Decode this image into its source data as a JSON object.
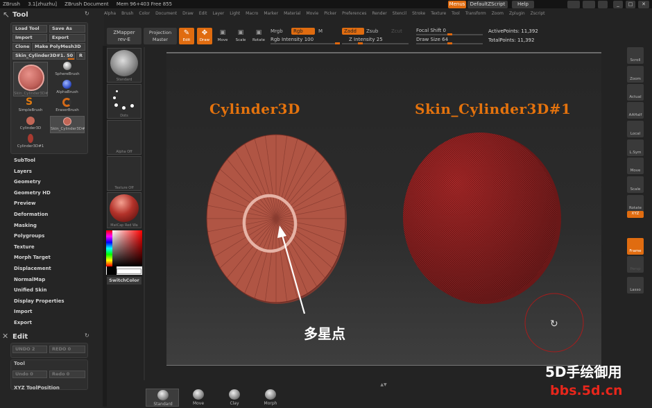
{
  "titlebar": {
    "app": "ZBrush",
    "version": "3.1[zhuzhu]",
    "document": "ZBrush Document",
    "mem": "Mem 96+403 Free 855"
  },
  "menubar": [
    "Alpha",
    "Brush",
    "Color",
    "Document",
    "Draw",
    "Edit",
    "Layer",
    "Light",
    "Macro",
    "Marker",
    "Material",
    "Movie",
    "Picker",
    "Preferences",
    "Render",
    "Stencil",
    "Stroke",
    "Texture",
    "Tool",
    "Transform",
    "Zoom",
    "Zplugin",
    "Zscript"
  ],
  "topright": {
    "menus": "Menus",
    "script": "DefaultZScript",
    "help": "Help"
  },
  "tool_panel": {
    "title": "Tool",
    "load_tool": "Load Tool",
    "save_as": "Save As",
    "import": "Import",
    "export": "Export",
    "clone": "Clone",
    "make_polymesh": "Make PolyMesh3D",
    "current_tool": "Skin_Cylinder3D#1. 50",
    "r_label": "R",
    "big_thumb_label": "Skin_Cylinder3D#",
    "thumbs": [
      {
        "label": "SphereBrush"
      },
      {
        "label": "AlphaBrush"
      },
      {
        "label": "SimpleBrush"
      },
      {
        "label": "EraserBrush"
      },
      {
        "label": "Cylinder3D"
      },
      {
        "label": "Skin_Cylinder3D#"
      },
      {
        "label": "Cylinder3D#1"
      }
    ],
    "menu_items": [
      "SubTool",
      "Layers",
      "Geometry",
      "Geometry HD",
      "Preview",
      "Deformation",
      "Masking",
      "Polygroups",
      "Texture",
      "Morph Target",
      "Displacement",
      "NormalMap",
      "Unified Skin",
      "Display Properties",
      "Import",
      "Export"
    ]
  },
  "edit_panel": {
    "title": "Edit",
    "undo": "UNDO 2",
    "redo": "REDO 0",
    "tool_label": "Tool",
    "undo2": "Undo 0",
    "redo2": "Redo 0",
    "xyz_position": "XYZ ToolPosition"
  },
  "brush_column": {
    "standard": "Standard",
    "dots": "Dots",
    "alpha": "Alpha  Off",
    "texture": "Texture  Off",
    "matcap": "MatCap Red Wa",
    "switch_color": "SwitchColor"
  },
  "toolbar": {
    "zmapper": "ZMapper",
    "zmapper_sub": "rev-E",
    "projection": "Projection",
    "projection_sub": "Master",
    "edit": "Edit",
    "draw": "Draw",
    "move": "Move",
    "scale": "Scale",
    "rotate": "Rotate",
    "mrgb": "Mrgb",
    "rgb": "Rgb",
    "m": "M",
    "rgb_intensity_label": "Rgb Intensity",
    "rgb_intensity": "100",
    "zadd": "Zadd",
    "zsub": "Zsub",
    "zcut": "Zcut",
    "z_intensity_label": "Z Intensity",
    "z_intensity": "25",
    "focal_shift_label": "Focal Shift",
    "focal_shift": "0",
    "draw_size_label": "Draw Size",
    "draw_size": "64",
    "active_points_label": "ActivePoints:",
    "active_points": "11,392",
    "total_points_label": "TotalPoints:",
    "total_points": "11,392"
  },
  "right_tools": [
    "Scroll",
    "Zoom",
    "Actual",
    "AAHalf",
    "Local",
    "L.Sym",
    "Move",
    "Scale",
    "Rotate",
    "XYZ",
    "Frame",
    "Persp",
    "Lasso"
  ],
  "canvas": {
    "label_left": "Cylinder3D",
    "label_right": "Skin_Cylinder3D#1",
    "annotation": "多星点"
  },
  "bottom_shelf": [
    "Standard",
    "Move",
    "Clay",
    "Morph"
  ],
  "watermark": {
    "line1": "5D手绘御用",
    "line2": "bbs.5d.cn"
  },
  "colors": {
    "accent": "#e06c10",
    "model": "#b05544",
    "skin_model": "#a82a2a",
    "title_orange": "#e5730d",
    "watermark_red": "#e8261b"
  }
}
